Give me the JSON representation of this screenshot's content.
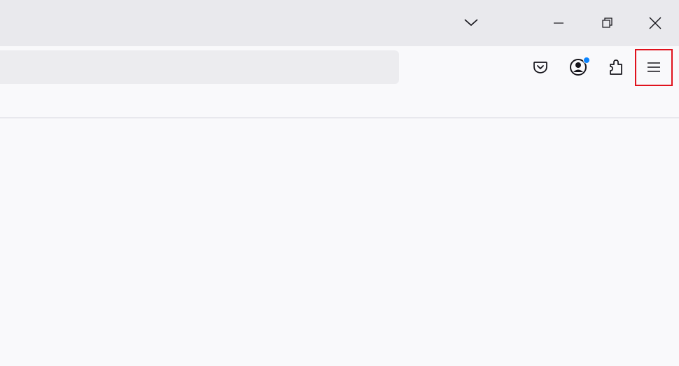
{
  "window": {
    "controls": {
      "list_all_tabs_icon": "chevron-down-icon",
      "minimize_icon": "minimize-icon",
      "restore_icon": "restore-icon",
      "close_icon": "close-icon"
    }
  },
  "navbar": {
    "address_bar": {
      "value": "",
      "placeholder": ""
    },
    "toolbar_buttons": [
      {
        "name": "pocket",
        "icon": "pocket-icon"
      },
      {
        "name": "account",
        "icon": "account-icon",
        "badge_color": "#0a84ff"
      },
      {
        "name": "extensions",
        "icon": "puzzle-icon"
      },
      {
        "name": "menu",
        "icon": "hamburger-menu-icon",
        "highlighted": true
      }
    ]
  },
  "colors": {
    "titlebar": "#e9e9ed",
    "toolbar": "#f9f9fb",
    "urlbar": "#ececef",
    "icon": "#15141a",
    "highlight_border": "#e0121d",
    "notification_dot": "#0a84ff"
  }
}
